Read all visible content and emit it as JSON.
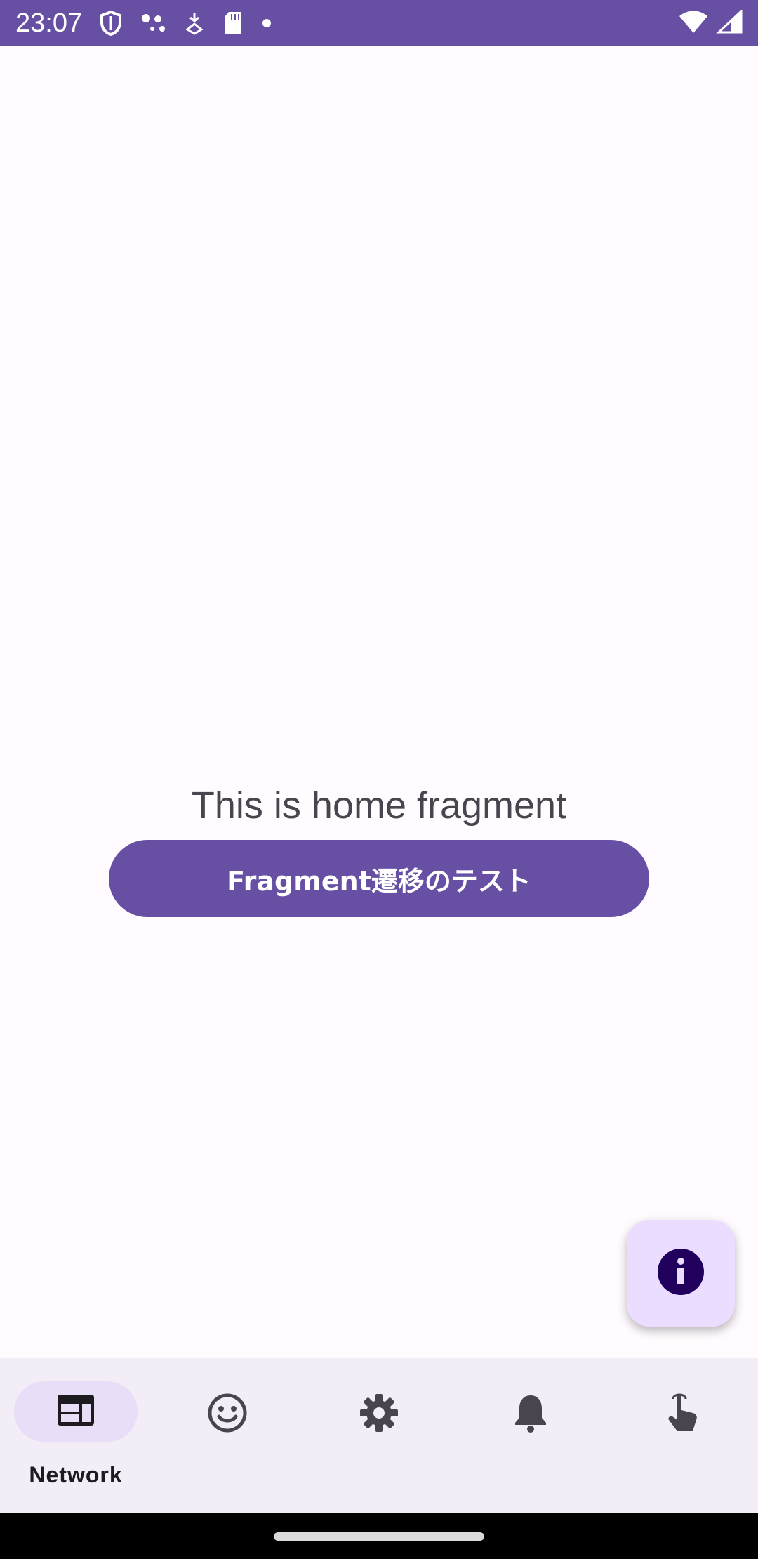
{
  "status_bar": {
    "time": "23:07",
    "left_icons": [
      "shield-icon",
      "dots-icon",
      "download-icon",
      "sd-card-icon",
      "dot-icon"
    ],
    "right_icons": [
      "wifi-icon",
      "signal-icon"
    ]
  },
  "main": {
    "home_text": "This is home fragment",
    "test_button_label": "Fragment遷移のテスト"
  },
  "fab": {
    "icon": "info-icon"
  },
  "bottom_nav": {
    "items": [
      {
        "label": "Network",
        "icon": "web-icon",
        "selected": true
      },
      {
        "label": "",
        "icon": "smiley-icon",
        "selected": false
      },
      {
        "label": "",
        "icon": "gear-icon",
        "selected": false
      },
      {
        "label": "",
        "icon": "bell-icon",
        "selected": false
      },
      {
        "label": "",
        "icon": "touch-icon",
        "selected": false
      }
    ]
  },
  "colors": {
    "primary": "#6750a4",
    "background": "#fffbfe",
    "nav_background": "#f2edf6",
    "indicator": "#e8def8",
    "fab_container": "#eaddff",
    "fab_icon": "#21005d",
    "text": "#49454f",
    "icon": "#49454f"
  }
}
